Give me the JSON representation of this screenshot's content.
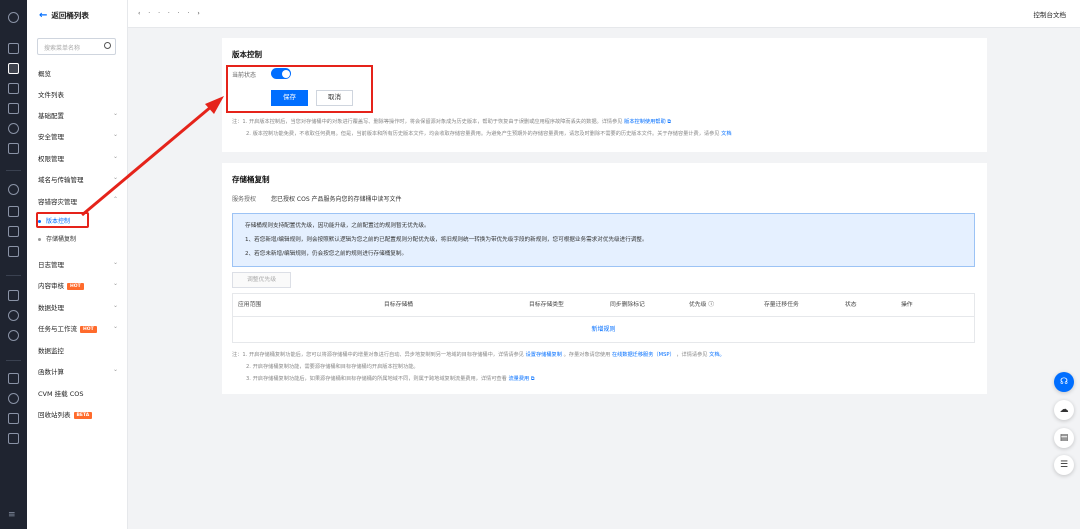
{
  "sidebar": {
    "back_label": "返回桶列表",
    "search_placeholder": "搜索菜单名称",
    "items": [
      {
        "label": "概览"
      },
      {
        "label": "文件列表"
      },
      {
        "label": "基础配置",
        "chevron": "⌄"
      },
      {
        "label": "安全管理",
        "chevron": "⌄"
      },
      {
        "label": "权限管理",
        "chevron": "⌄"
      },
      {
        "label": "域名与传输管理",
        "chevron": "⌄"
      },
      {
        "label": "容错容灾管理",
        "chevron": "⌃"
      },
      {
        "label": "版本控制"
      },
      {
        "label": "存储桶复制"
      },
      {
        "label": "日志管理",
        "chevron": "⌄"
      },
      {
        "label": "内容审核",
        "badge": "HOT",
        "chevron": "⌄"
      },
      {
        "label": "数据处理",
        "chevron": "⌄"
      },
      {
        "label": "任务与工作流",
        "badge": "HOT",
        "chevron": "⌄"
      },
      {
        "label": "数据监控"
      },
      {
        "label": "函数计算",
        "chevron": "⌄"
      },
      {
        "label": "CVM 挂载 COS"
      },
      {
        "label": "回收站列表",
        "badge": "BETA"
      }
    ]
  },
  "topbar": {
    "breadcrumb": "‹  ·  ·  ·  ·  ·  ›",
    "doc_link": "控制台文档"
  },
  "version_control": {
    "title": "版本控制",
    "status_label": "当前状态",
    "enabled": true,
    "save_label": "保存",
    "cancel_label": "取消",
    "note1_text": "注：1. 开启版本控制后，当您对存储桶中的对象进行覆盖写、删除等操作时，将会保留源对象成为历史版本，帮助于恢复由于误删或应用程序故障而丢失的数据。详情参见",
    "note1_link": "版本控制使用帮助",
    "note2_text": "2. 版本控制功能免费，不收取任何费用。但是，当前版本和所有历史版本文件，均会收取存储容量费用。为避免产生预期外的存储容量费用，请您及时删除不需要的历史版本文件。关于存储容量计费，请参见",
    "note2_link": "文档"
  },
  "replication": {
    "title": "存储桶复制",
    "auth_label": "服务授权",
    "auth_text": "您已授权 COS 产品服务向您的存储桶中读写文件",
    "info_line1": "存储桶规则支持配置优先级，因功能升级，之前配置过的规则暂无优先级。",
    "info_line2": "1、若您新增/编辑规则，则会按照默认逻辑为您之前的已配置规则分配优先级，将旧规则统一转换为带优先级字段的新规则，您可根据业务需求对优先级进行调整。",
    "info_line3": "2、若您未新增/编辑规则，仍会按您之前的规则进行存储桶复制。",
    "adjust_button": "调整优先级",
    "columns": [
      "应用范围",
      "目标存储桶",
      "目标存储类型",
      "同步删除标记",
      "优先级 ⓘ",
      "存量迁移任务",
      "状态",
      "操作"
    ],
    "add_rule": "新增规则",
    "note1_text": "注：1. 开启存储桶复制功能后，您可以将源存储桶中的增量对象进行自动、异步地复制到另一地域的目标存储桶中，详情请参见",
    "note1_link": "设置存储桶复制",
    "note1_mid": "。存量对象请您使用",
    "note1_link2": "在线数据迁移服务（MSP）",
    "note1_end": "，详情请参见",
    "note1_link3": "文档。",
    "note2_text": "2. 开启存储桶复制功能，需要源存储桶和目标存储桶均开启版本控制功能。",
    "note3_text": "3. 开启存储桶复制功能后，如果源存储桶和目标存储桶的所属地域不同，则属于跨地域复制流量费用，详情可查看",
    "note3_link": "流量费用"
  },
  "fabs": [
    "headset-icon",
    "cloud-icon",
    "book-icon",
    "list-icon"
  ],
  "colors": {
    "accent": "#006eff",
    "annotation": "#e5231a"
  }
}
